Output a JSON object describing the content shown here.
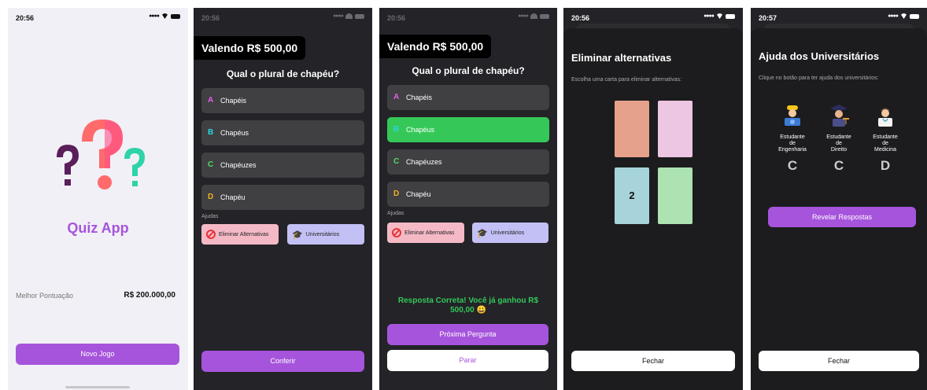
{
  "status": {
    "time1": "20:56",
    "time2": "20:56",
    "time3": "20:56",
    "time4": "20:56",
    "time5": "20:57"
  },
  "home": {
    "app_title": "Quiz App",
    "best_label": "Melhor Pontuação",
    "best_value": "R$ 200.000,00",
    "new_game": "Novo Jogo"
  },
  "quiz": {
    "valendo": "Valendo R$ 500,00",
    "question": "Qual o plural de chapéu?",
    "options": [
      {
        "letter": "A",
        "text": "Chapéis",
        "color": "#e060e8"
      },
      {
        "letter": "B",
        "text": "Chapéus",
        "color": "#2ad4e0"
      },
      {
        "letter": "C",
        "text": "Chapéuzes",
        "color": "#58d868"
      },
      {
        "letter": "D",
        "text": "Chapéu",
        "color": "#f0b020"
      }
    ],
    "ajudas_label": "Ajudas",
    "eliminar": "Eliminar Alternativas",
    "universitarios": "Universitários",
    "conferir": "Conferir"
  },
  "result": {
    "success": "Resposta Correta! Você já ganhou R$ 500,00 😀",
    "next": "Próxima Pergunta",
    "stop": "Parar"
  },
  "eliminar": {
    "title": "Eliminar alternativas",
    "desc": "Escolha uma carta para eliminar alternativas:",
    "revealed_card": "2",
    "close": "Fechar"
  },
  "universitarios": {
    "title": "Ajuda dos Universitários",
    "desc": "Clique no botão para ter ajuda dos universitários:",
    "students": [
      {
        "label_l1": "Estudante",
        "label_l2": "de",
        "label_l3": "Engenharia",
        "answer": "C"
      },
      {
        "label_l1": "Estudante",
        "label_l2": "de",
        "label_l3": "Direito",
        "answer": "C"
      },
      {
        "label_l1": "Estudante",
        "label_l2": "de",
        "label_l3": "Medicina",
        "answer": "D"
      }
    ],
    "reveal": "Revelar Respostas",
    "close": "Fechar"
  }
}
